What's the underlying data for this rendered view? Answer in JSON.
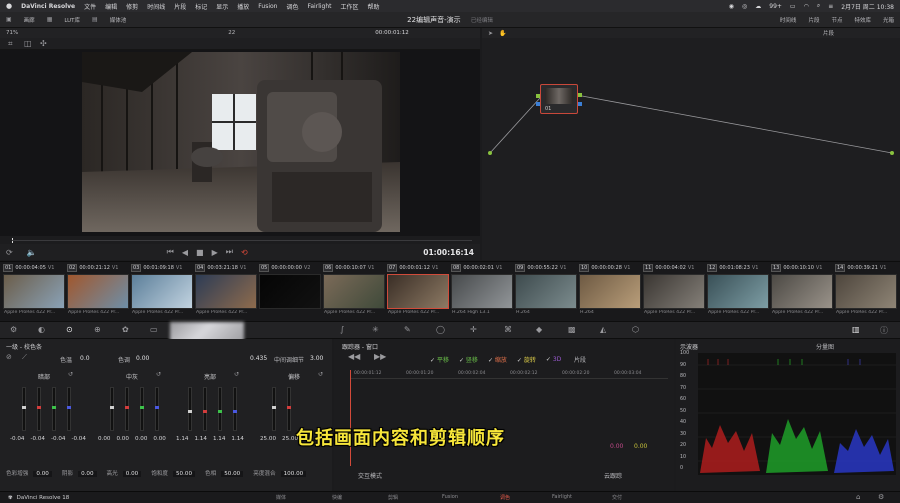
{
  "menubar": {
    "app_name": "DaVinci Resolve",
    "items": [
      "文件",
      "编辑",
      "修剪",
      "时间线",
      "片段",
      "标记",
      "显示",
      "播放",
      "Fusion",
      "调色",
      "Fairlight",
      "工作区",
      "帮助"
    ],
    "battery": "99+",
    "datetime": "2月7日 周二  10:38"
  },
  "toolbar": {
    "gallery": "画廊",
    "lut_browser": "LUT库",
    "media_pool": "媒体池",
    "project_title": "22编辑声音-演示",
    "edited_label": "已经编辑",
    "timeline_label": "时间线",
    "clips_label": "片段",
    "nodes_label": "节点",
    "effects_label": "特效库",
    "lightbox_label": "光箱"
  },
  "viewer": {
    "zoom": "71%",
    "clip_number": "22",
    "source_tc": "00:00:01:12",
    "timecode": "01:00:16:14"
  },
  "node_editor": {
    "mode": "片段",
    "node_label": "01"
  },
  "clips": [
    {
      "num": "01",
      "tc": "00:00:04:05",
      "track": "V1",
      "label": "Apple ProRes 422 Pr...",
      "colors": [
        "#6b5d4a",
        "#8aa2b7"
      ]
    },
    {
      "num": "02",
      "tc": "00:00:21:12",
      "track": "V1",
      "label": "Apple ProRes 422 Pr...",
      "colors": [
        "#a0572e",
        "#6e8fa8"
      ]
    },
    {
      "num": "03",
      "tc": "00:01:09:18",
      "track": "V1",
      "label": "Apple ProRes 422 Pr...",
      "colors": [
        "#5c7f9a",
        "#c2d3e0"
      ]
    },
    {
      "num": "04",
      "tc": "00:03:21:18",
      "track": "V1",
      "label": "Apple ProRes 422 Pr...",
      "colors": [
        "#2d3c55",
        "#8e6b4d"
      ]
    },
    {
      "num": "05",
      "tc": "00:00:00:00",
      "track": "V2",
      "label": "",
      "colors": [
        "#050505",
        "#111111"
      ]
    },
    {
      "num": "06",
      "tc": "00:00:10:07",
      "track": "V1",
      "label": "Apple ProRes 422 Pr...",
      "colors": [
        "#7b6a58",
        "#3f4a3a"
      ]
    },
    {
      "num": "07",
      "tc": "00:00:01:12",
      "track": "V1",
      "label": "Apple ProRes 422 Pr...",
      "colors": [
        "#3a2e26",
        "#8d7a64"
      ]
    },
    {
      "num": "08",
      "tc": "00:00:02:01",
      "track": "V1",
      "label": "H.264 High L3.1",
      "colors": [
        "#474a4c",
        "#929699"
      ]
    },
    {
      "num": "09",
      "tc": "00:00:55:22",
      "track": "V1",
      "label": "H.264",
      "colors": [
        "#3e4b4e",
        "#7c8c8e"
      ]
    },
    {
      "num": "10",
      "tc": "00:00:00:28",
      "track": "V1",
      "label": "H.264",
      "colors": [
        "#6e5a43",
        "#b99e7a"
      ]
    },
    {
      "num": "11",
      "tc": "00:00:04:02",
      "track": "V1",
      "label": "Apple ProRes 422 Pr...",
      "colors": [
        "#3a3632",
        "#858079"
      ]
    },
    {
      "num": "12",
      "tc": "00:01:08:23",
      "track": "V1",
      "label": "Apple ProRes 422 Pr...",
      "colors": [
        "#395057",
        "#7e9ea5"
      ]
    },
    {
      "num": "13",
      "tc": "00:00:10:10",
      "track": "V1",
      "label": "Apple ProRes 422 Pr...",
      "colors": [
        "#4c4944",
        "#9a938a"
      ]
    },
    {
      "num": "14",
      "tc": "00:00:39:21",
      "track": "V1",
      "label": "Apple ProRes 422 Pr...",
      "colors": [
        "#4e463d",
        "#8f8576"
      ]
    }
  ],
  "wheels_panel": {
    "title": "一级 - 校色条",
    "temp_label": "色温",
    "temp_value": "0.0",
    "tint_label": "色调",
    "tint_value": "0.00",
    "contrast_value": "0.435",
    "pivot_label": "中间调细节",
    "pivot_value": "3.00",
    "wheels": [
      {
        "name": "暗部",
        "values": [
          "-0.04",
          "-0.04",
          "-0.04",
          "-0.04"
        ]
      },
      {
        "name": "中灰",
        "values": [
          "0.00",
          "0.00",
          "0.00",
          "0.00"
        ]
      },
      {
        "name": "亮部",
        "values": [
          "1.14",
          "1.14",
          "1.14",
          "1.14"
        ]
      },
      {
        "name": "偏移",
        "values": [
          "25.00",
          "25.00"
        ]
      }
    ],
    "params": [
      {
        "label": "色彩增强",
        "value": "0.00"
      },
      {
        "label": "阴影",
        "value": "0.00"
      },
      {
        "label": "高光",
        "value": "0.00"
      },
      {
        "label": "饱和度",
        "value": "50.00"
      },
      {
        "label": "色相",
        "value": "50.00"
      },
      {
        "label": "亮度混合",
        "value": "100.00"
      }
    ]
  },
  "keyframes_panel": {
    "title": "跟踪器 - 窗口",
    "options": [
      "平移",
      "竖移",
      "缩放",
      "旋转",
      "3D"
    ],
    "clip_label": "片段",
    "ruler": [
      "00:00:01:12",
      "00:00:01:20",
      "00:00:02:04",
      "00:00:02:12",
      "00:00:02:20",
      "00:00:03:04"
    ],
    "interactive_label": "交互模式",
    "cloud_label": "云跟踪",
    "value_a": "0.00",
    "value_b": "0.00"
  },
  "scope": {
    "title": "示波器",
    "mode": "分量图",
    "ticks": [
      "100",
      "90",
      "80",
      "70",
      "60",
      "50",
      "40",
      "30",
      "20",
      "10",
      "0"
    ]
  },
  "pagebar": {
    "brand": "DaVinci Resolve 18",
    "pages": [
      "媒体",
      "快编",
      "剪辑",
      "Fusion",
      "调色",
      "Fairlight",
      "交付"
    ]
  },
  "subtitle": "包括画面内容和剪辑顺序"
}
